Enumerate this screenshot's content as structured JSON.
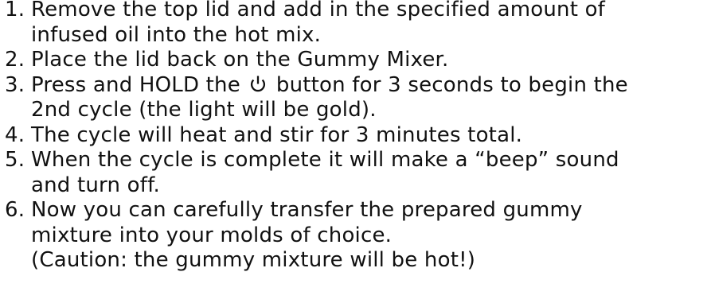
{
  "steps": [
    {
      "number": "1.",
      "lines": [
        "Remove the top lid and add in the specified amount of",
        "infused oil into the hot mix."
      ]
    },
    {
      "number": "2.",
      "lines": [
        "Place the lid back on the Gummy Mixer."
      ]
    },
    {
      "number": "3.",
      "line1_before_icon": "Press and HOLD the",
      "icon": "power-icon",
      "line1_after_icon": "button for 3 seconds to begin the",
      "line2": "2nd cycle (the light will be gold)."
    },
    {
      "number": "4.",
      "lines": [
        "The cycle will heat and stir for 3 minutes total."
      ]
    },
    {
      "number": "5.",
      "lines": [
        "When the cycle is complete it will make a “beep” sound",
        "and turn off."
      ]
    },
    {
      "number": "6.",
      "lines": [
        "Now you can carefully transfer the prepared gummy",
        "mixture into your molds of choice.",
        "(Caution: the gummy mixture will be hot!)"
      ]
    }
  ]
}
